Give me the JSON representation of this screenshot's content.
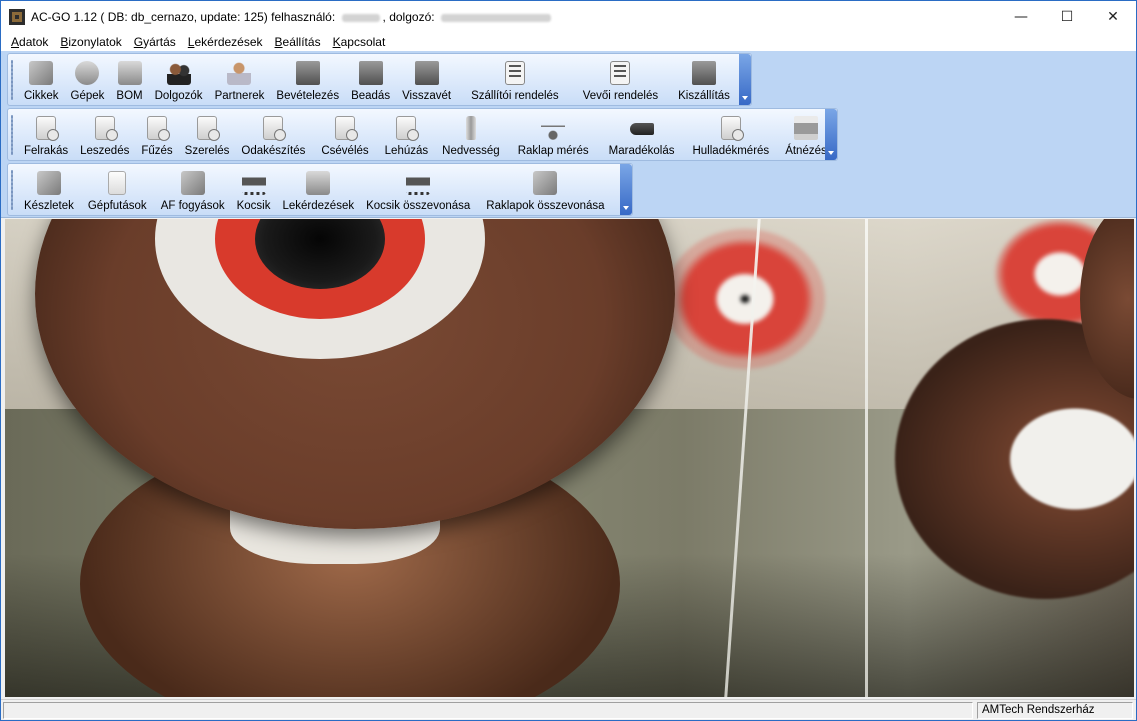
{
  "window": {
    "title_prefix": "AC-GO 1.12 ( DB: db_cernazo, update: 125) felhasználó:",
    "title_middle": "dolgozó:",
    "controls": {
      "minimize": "—",
      "maximize": "☐",
      "close": "✕"
    }
  },
  "menu": [
    {
      "first": "A",
      "rest": "datok"
    },
    {
      "first": "B",
      "rest": "izonylatok"
    },
    {
      "first": "G",
      "rest": "yártás"
    },
    {
      "first": "L",
      "rest": "ekérdezések"
    },
    {
      "first": "B",
      "rest": "eállítás"
    },
    {
      "first": "K",
      "rest": "apcsolat"
    }
  ],
  "toolbar1": [
    {
      "label": "Cikkek",
      "icon": "boxes-icon"
    },
    {
      "label": "Gépek",
      "icon": "machine-icon"
    },
    {
      "label": "BOM",
      "icon": "bom-icon"
    },
    {
      "label": "Dolgozók",
      "icon": "people-icon"
    },
    {
      "label": "Partnerek",
      "icon": "partner-icon"
    },
    {
      "label": "Bevételezés",
      "icon": "truck-in-icon"
    },
    {
      "label": "Beadás",
      "icon": "truck-deliver-icon"
    },
    {
      "label": "Visszavét",
      "icon": "truck-return-icon"
    },
    {
      "label": "Szállítói rendelés",
      "icon": "supplier-order-icon"
    },
    {
      "label": "Vevői rendelés",
      "icon": "customer-order-icon"
    },
    {
      "label": "Kiszállítás",
      "icon": "truck-ship-icon"
    }
  ],
  "toolbar2": [
    {
      "label": "Felrakás",
      "icon": "doc-clock-icon"
    },
    {
      "label": "Leszedés",
      "icon": "doc-clock-icon"
    },
    {
      "label": "Fűzés",
      "icon": "doc-clock-icon"
    },
    {
      "label": "Szerelés",
      "icon": "doc-clock-icon"
    },
    {
      "label": "Odakészítés",
      "icon": "doc-clock-icon"
    },
    {
      "label": "Csévélés",
      "icon": "doc-clock-icon"
    },
    {
      "label": "Lehúzás",
      "icon": "doc-clock-icon"
    },
    {
      "label": "Nedvesség",
      "icon": "bottle-icon"
    },
    {
      "label": "Raklap mérés",
      "icon": "scale-icon"
    },
    {
      "label": "Maradékolás",
      "icon": "stapler-icon"
    },
    {
      "label": "Hulladékmérés",
      "icon": "waste-icon"
    },
    {
      "label": "Átnézés",
      "icon": "printer-icon"
    }
  ],
  "toolbar3": [
    {
      "label": "Készletek",
      "icon": "stock-icon"
    },
    {
      "label": "Gépfutások",
      "icon": "blank-doc-icon"
    },
    {
      "label": "AF fogyások",
      "icon": "consumption-icon"
    },
    {
      "label": "Kocsik",
      "icon": "cart-icon"
    },
    {
      "label": "Lekérdezések",
      "icon": "query-icon"
    },
    {
      "label": "Kocsik összevonása",
      "icon": "cart-merge-icon"
    },
    {
      "label": "Raklapok összevonása",
      "icon": "pallet-merge-icon"
    }
  ],
  "status": {
    "right": "AMTech Rendszerház"
  }
}
